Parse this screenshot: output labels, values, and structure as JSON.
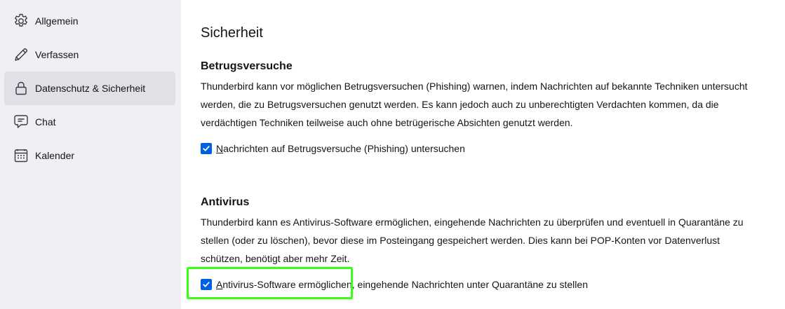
{
  "sidebar": {
    "items": [
      {
        "label": "Allgemein",
        "icon": "gear-icon"
      },
      {
        "label": "Verfassen",
        "icon": "pencil-icon"
      },
      {
        "label": "Datenschutz & Sicherheit",
        "icon": "lock-icon",
        "active": true
      },
      {
        "label": "Chat",
        "icon": "chat-icon"
      },
      {
        "label": "Kalender",
        "icon": "calendar-icon"
      }
    ]
  },
  "main": {
    "title": "Sicherheit",
    "phishing": {
      "heading": "Betrugsversuche",
      "description": "Thunderbird kann vor möglichen Betrugsversuchen (Phishing) warnen, indem Nachrichten auf bekannte Techniken untersucht werden, die zu Betrugsversuchen genutzt werden. Es kann jedoch auch zu unberechtigten Verdachten kommen, da die verdächtigen Techniken teilweise auch ohne betrügerische Absichten genutzt werden.",
      "checkbox_accesskey": "N",
      "checkbox_rest": "achrichten auf Betrugsversuche (Phishing) untersuchen",
      "checked": true
    },
    "antivirus": {
      "heading": "Antivirus",
      "description": "Thunderbird kann es Antivirus-Software ermöglichen, eingehende Nachrichten zu überprüfen und eventuell in Quarantäne zu stellen (oder zu löschen), bevor diese im Posteingang gespeichert werden. Dies kann bei POP-Konten vor Datenverlust schützen, benötigt aber mehr Zeit.",
      "checkbox_accesskey": "A",
      "checkbox_rest": "ntivirus-Software ermöglichen, eingehende Nachrichten unter Quarantäne zu stellen",
      "checked": true
    }
  },
  "colors": {
    "sidebar_bg": "#f0f0f4",
    "active_item_bg": "#e0e0e6",
    "checkbox_accent": "#0061e0",
    "highlight_outline": "#39ff14"
  }
}
